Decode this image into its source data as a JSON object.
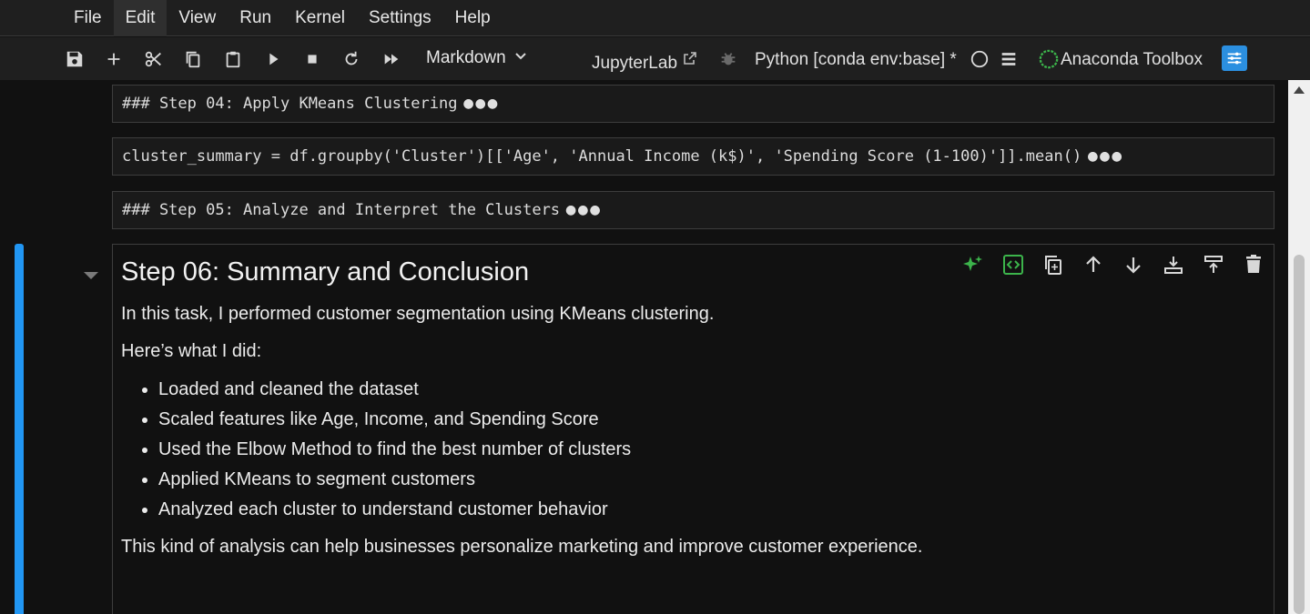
{
  "menu": [
    "File",
    "Edit",
    "View",
    "Run",
    "Kernel",
    "Settings",
    "Help"
  ],
  "toolbar": {
    "cell_type": "Markdown",
    "jupyterlab_label": "JupyterLab",
    "kernel_name": "Python [conda env:base] *",
    "anaconda_label": "Anaconda Toolbox"
  },
  "cells": {
    "cell1": "### Step 04: Apply KMeans Clustering",
    "cell2": "cluster_summary = df.groupby('Cluster')[['Age', 'Annual Income (k$)', 'Spending Score (1-100)']].mean()",
    "cell3": "### Step 05: Analyze and Interpret the Clusters",
    "ellipsis": "●●●"
  },
  "markdown": {
    "heading": "Step 06: Summary and Conclusion",
    "intro": "In this task, I performed customer segmentation using KMeans clustering.",
    "lead": "Here’s what I did:",
    "items": [
      "Loaded and cleaned the dataset",
      "Scaled features like Age, Income, and Spending Score",
      "Used the Elbow Method to find the best number of clusters",
      "Applied KMeans to segment customers",
      "Analyzed each cluster to understand customer behavior"
    ],
    "closing": "This kind of analysis can help businesses personalize marketing and improve customer experience."
  },
  "colors": {
    "active_cell_bar": "#2196f3",
    "ai_green": "#3cb44b",
    "anaconda_blue": "#2b8fe0"
  }
}
